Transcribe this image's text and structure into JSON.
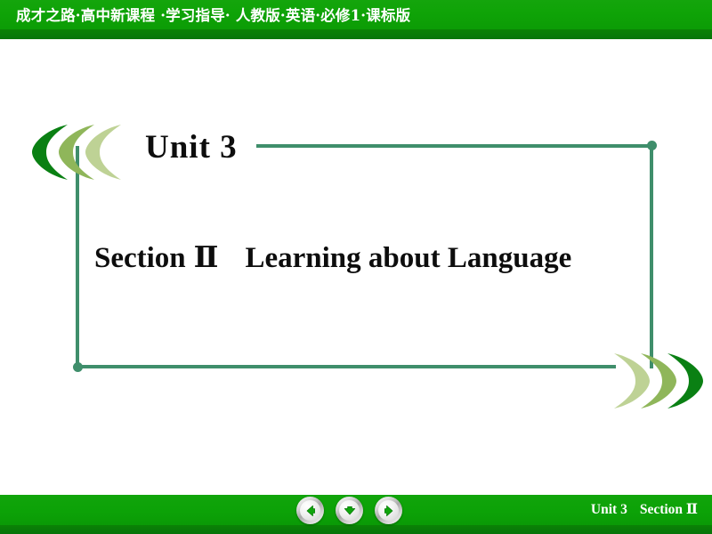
{
  "header": {
    "title": "成才之路·高中新课程 ·学习指导· 人教版·英语·必修1·课标版",
    "bg_color": "#0fa307",
    "text_color": "#ffffff"
  },
  "slide": {
    "unit_title": "Unit 3",
    "section_label": "Section",
    "section_number": "Ⅱ",
    "section_title": "Learning about Language",
    "frame_color": "#3f8e6b",
    "chevron_colors": {
      "dark": "#0a8013",
      "medium": "#8fb65a",
      "light": "#bed295"
    }
  },
  "footer": {
    "prev_label": "Previous slide",
    "down_label": "Next animation",
    "next_label": "Next slide",
    "prev_icon": "arrow-left-icon",
    "down_icon": "arrow-down-icon",
    "next_icon": "arrow-right-icon",
    "unit_label": "Unit 3",
    "section_label": "Section",
    "section_number": "Ⅱ",
    "bg_color": "#0ca207",
    "text_color": "#ffffff"
  }
}
